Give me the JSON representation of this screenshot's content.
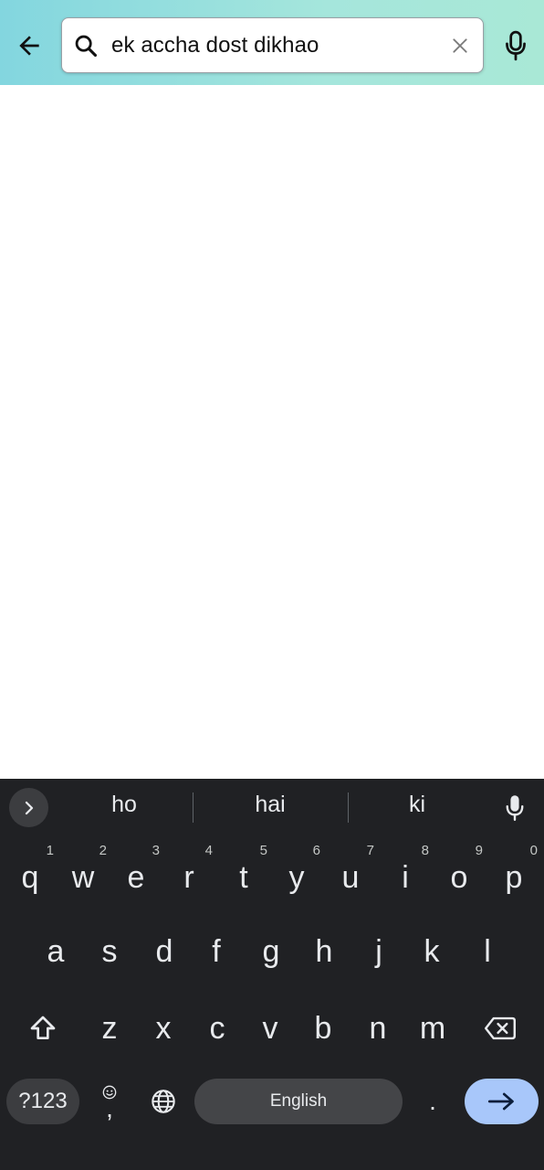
{
  "search": {
    "query": "ek accha dost dikhao",
    "icons": {
      "back": "arrow-left-icon",
      "search": "search-icon",
      "clear": "close-icon",
      "voice": "microphone-icon"
    }
  },
  "keyboard": {
    "suggestions": [
      "ho",
      "hai",
      "ki"
    ],
    "rows": {
      "row1": [
        {
          "key": "q",
          "hint": "1"
        },
        {
          "key": "w",
          "hint": "2"
        },
        {
          "key": "e",
          "hint": "3"
        },
        {
          "key": "r",
          "hint": "4"
        },
        {
          "key": "t",
          "hint": "5"
        },
        {
          "key": "y",
          "hint": "6"
        },
        {
          "key": "u",
          "hint": "7"
        },
        {
          "key": "i",
          "hint": "8"
        },
        {
          "key": "o",
          "hint": "9"
        },
        {
          "key": "p",
          "hint": "0"
        }
      ],
      "row2": [
        "a",
        "s",
        "d",
        "f",
        "g",
        "h",
        "j",
        "k",
        "l"
      ],
      "row3": [
        "z",
        "x",
        "c",
        "v",
        "b",
        "n",
        "m"
      ]
    },
    "symbols_label": "?123",
    "emoji_comma": ",",
    "space_label": "English",
    "period_label": ".",
    "colors": {
      "background": "#202124",
      "key_text": "#e8eaed",
      "enter_key": "#a8c7fa",
      "header_gradient_start": "#83d6df",
      "header_gradient_end": "#a9e8d6"
    }
  }
}
